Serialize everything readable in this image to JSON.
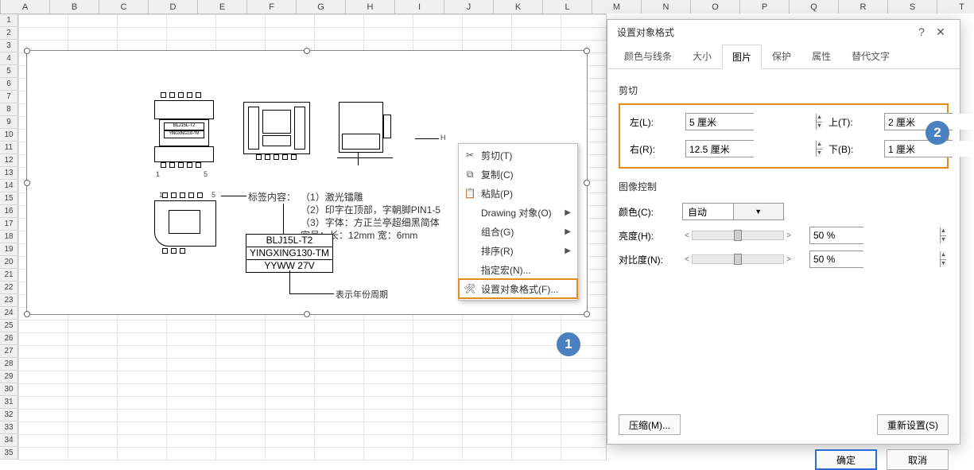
{
  "columns": [
    "A",
    "B",
    "C",
    "D",
    "E",
    "F",
    "G",
    "H",
    "I",
    "J",
    "K",
    "L",
    "M",
    "N",
    "O",
    "P",
    "Q",
    "R",
    "S",
    "T"
  ],
  "row_count": 35,
  "drawing": {
    "label_header": "标签内容：",
    "lines": [
      "（1）激光镭雕",
      "（2）印字在顶部，字朝脚PIN1-5",
      "（3）字体：方正兰亭超细黑简体",
      "字号：长：12mm 宽：6mm"
    ],
    "title_box": [
      "BLJ15L-T2",
      "YINGXING130-TM",
      "YYWW   27V"
    ],
    "part_labels": {
      "a": [
        "1",
        "5"
      ],
      "b": [
        "1",
        "5"
      ]
    },
    "footer": "表示年份周期"
  },
  "context_menu": {
    "items": [
      {
        "icon": "✂",
        "label": "剪切(T)"
      },
      {
        "icon": "⧉",
        "label": "复制(C)"
      },
      {
        "icon": "📋",
        "label": "粘贴(P)"
      },
      {
        "icon": "",
        "label": "Drawing 对象(O)",
        "submenu": true
      },
      {
        "icon": "",
        "label": "组合(G)",
        "submenu": true
      },
      {
        "icon": "",
        "label": "排序(R)",
        "submenu": true
      },
      {
        "icon": "",
        "label": "指定宏(N)..."
      },
      {
        "icon": "🛠",
        "label": "设置对象格式(F)...",
        "highlight": true
      }
    ]
  },
  "badges": {
    "one": "1",
    "two": "2"
  },
  "dialog": {
    "title": "设置对象格式",
    "help": "?",
    "close": "✕",
    "tabs": [
      "颜色与线条",
      "大小",
      "图片",
      "保护",
      "属性",
      "替代文字"
    ],
    "active_tab": 2,
    "crop": {
      "section": "剪切",
      "left": {
        "label": "左(L):",
        "value": "5 厘米"
      },
      "right": {
        "label": "右(R):",
        "value": "12.5 厘米"
      },
      "top": {
        "label": "上(T):",
        "value": "2 厘米"
      },
      "bottom": {
        "label": "下(B):",
        "value": "1 厘米"
      }
    },
    "image_ctrl": {
      "section": "图像控制",
      "color": {
        "label": "颜色(C):",
        "value": "自动"
      },
      "brightness": {
        "label": "亮度(H):",
        "value": "50 %"
      },
      "contrast": {
        "label": "对比度(N):",
        "value": "50 %"
      }
    },
    "buttons": {
      "compress": "压缩(M)...",
      "reset": "重新设置(S)",
      "ok": "确定",
      "cancel": "取消"
    }
  }
}
